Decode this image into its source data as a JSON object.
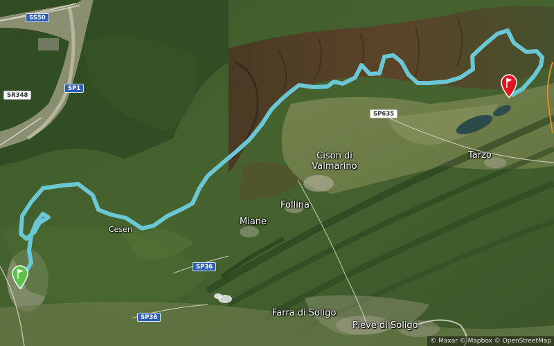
{
  "map": {
    "basemap": "satellite",
    "route_color": "#6cc7d4",
    "start_marker_color": "#5cc24a",
    "end_marker_color": "#e8121f"
  },
  "labels": {
    "cison": "Cison di\nValmarino",
    "follina": "Follina",
    "miane": "Miane",
    "cesen": "Cesen",
    "tarzo": "Tarzo",
    "farra": "Farra di Soligo",
    "pieve": "Pieve di Soligo"
  },
  "roads": {
    "ss50": "SS50",
    "sr348": "SR348",
    "sp1": "SP1",
    "sp635": "SP635",
    "sp36_upper": "SP36",
    "sp36_lower": "SP36"
  },
  "markers": {
    "start": "start-flag-icon",
    "end": "finish-flag-icon"
  },
  "attribution": "© Maxar © Mapbox © OpenStreetMap"
}
